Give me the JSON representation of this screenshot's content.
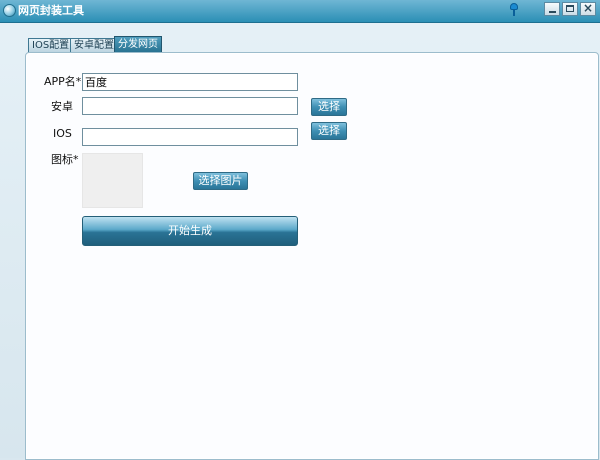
{
  "window": {
    "title": "网页封装工具"
  },
  "tabs": [
    {
      "label": "IOS配置",
      "active": false
    },
    {
      "label": "安卓配置",
      "active": false
    },
    {
      "label": "分发网页",
      "active": true
    }
  ],
  "form": {
    "app_name_label": "APP名*",
    "app_name_value": "百度",
    "android_label": "安卓",
    "android_value": "",
    "android_select_label": "选择",
    "ios_label": "IOS",
    "ios_value": "",
    "ios_select_label": "选择",
    "icon_label": "图标*",
    "select_image_label": "选择图片",
    "generate_label": "开始生成"
  },
  "icons": {
    "app": "app-globe-icon",
    "pin": "pin-icon",
    "minimize": "minimize-icon",
    "maximize": "maximize-icon",
    "close": "close-icon"
  },
  "colors": {
    "titlebar": "#2b8fb5",
    "active_tab": "#26708f",
    "button": "#3e8fb3"
  }
}
